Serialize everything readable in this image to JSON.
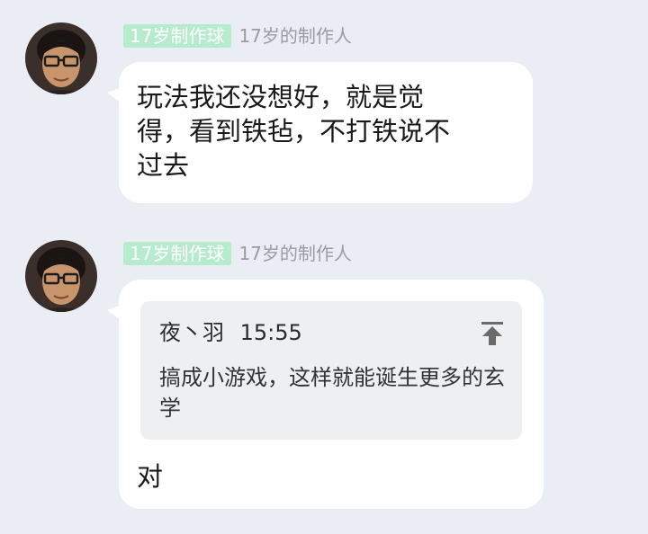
{
  "messages": [
    {
      "badge": "17岁制作球",
      "sender": "17岁的制作人",
      "text": "玩法我还没想好，就是觉\n得，看到铁毡，不打铁说不\n过去"
    },
    {
      "badge": "17岁制作球",
      "sender": "17岁的制作人",
      "quote": {
        "author": "夜丶羽",
        "time": "15:55",
        "text": "搞成小游戏，这样就能诞生更多的玄学",
        "icon": "jump-to-top-icon"
      },
      "text": "对"
    }
  ],
  "colors": {
    "background": "#eaedf4",
    "badge_bg": "#b7ebcd",
    "sender": "#9b9ba3",
    "bubble": "#ffffff",
    "quote_bg": "#eeeff1"
  }
}
